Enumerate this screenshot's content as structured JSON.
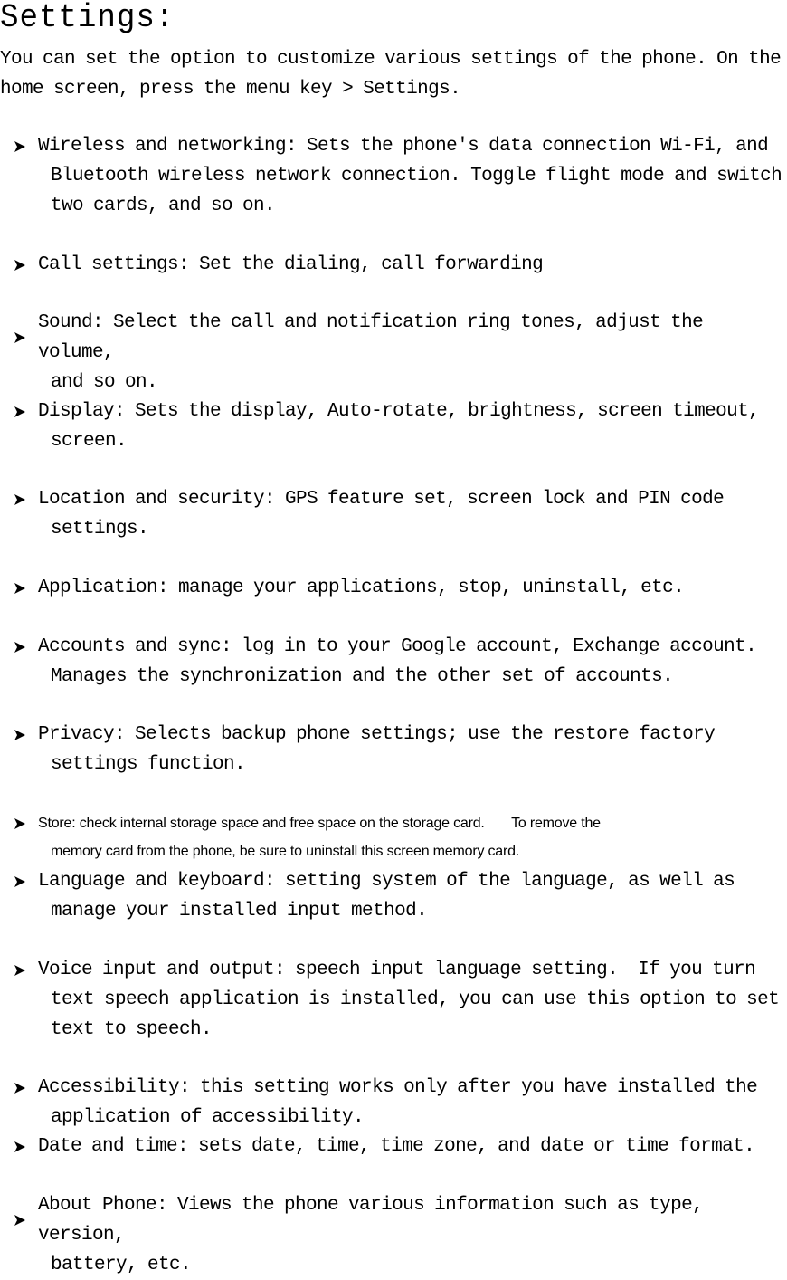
{
  "document": {
    "title": "Settings:",
    "intro": "You can set the option to customize various settings of the phone.  On the home screen, press the menu key > Settings.",
    "bullet_icon": "arrowhead-bullet-icon",
    "items": [
      {
        "label": "Wireless and networking",
        "line1": "Wireless and networking: Sets the phone's data connection Wi-Fi, and",
        "line2": "Bluetooth wireless network connection. Toggle flight mode and switch",
        "line3": "two cards, and so on."
      },
      {
        "label": "Call settings",
        "line1": "Call settings: Set the dialing, call forwarding"
      },
      {
        "label": "Sound",
        "line1": "Sound: Select the call and notification ring tones, adjust the volume,",
        "line2": "and so on."
      },
      {
        "label": "Display",
        "line1": "Display: Sets the display, Auto-rotate, brightness, screen timeout,",
        "line2": "screen."
      },
      {
        "label": "Location and security",
        "line1": "Location and security: GPS feature set, screen lock and PIN code",
        "line2": "settings."
      },
      {
        "label": "Application",
        "line1": "Application: manage your applications, stop, uninstall, etc."
      },
      {
        "label": "Accounts and sync",
        "line1": "Accounts and sync: log in to your Google account, Exchange account.",
        "line2": "Manages the synchronization and the other set of accounts."
      },
      {
        "label": "Privacy",
        "line1": "Privacy: Selects backup phone settings; use the restore factory",
        "line2": "settings function."
      },
      {
        "label": "Store",
        "line1": "Store: check internal storage space and free space on the storage card.       To remove the",
        "line2": "memory card from the phone, be sure to uninstall this screen memory card."
      },
      {
        "label": "Language and keyboard",
        "line1": "Language and keyboard: setting system of the language, as well as",
        "line2": "manage your installed input method."
      },
      {
        "label": "Voice input and output",
        "line1": "Voice input and output: speech input language setting.  If you turn",
        "line2": "text speech application is installed, you can use this option to set",
        "line3": "text to speech."
      },
      {
        "label": "Accessibility",
        "line1": "Accessibility: this setting works only after you have installed the",
        "line2": "application of accessibility."
      },
      {
        "label": "Date and time",
        "line1": "Date and time: sets date, time, time zone, and date or time format."
      },
      {
        "label": "About Phone",
        "line1": "About Phone: Views the phone various information such as type, version,",
        "line2": "battery, etc."
      }
    ]
  }
}
